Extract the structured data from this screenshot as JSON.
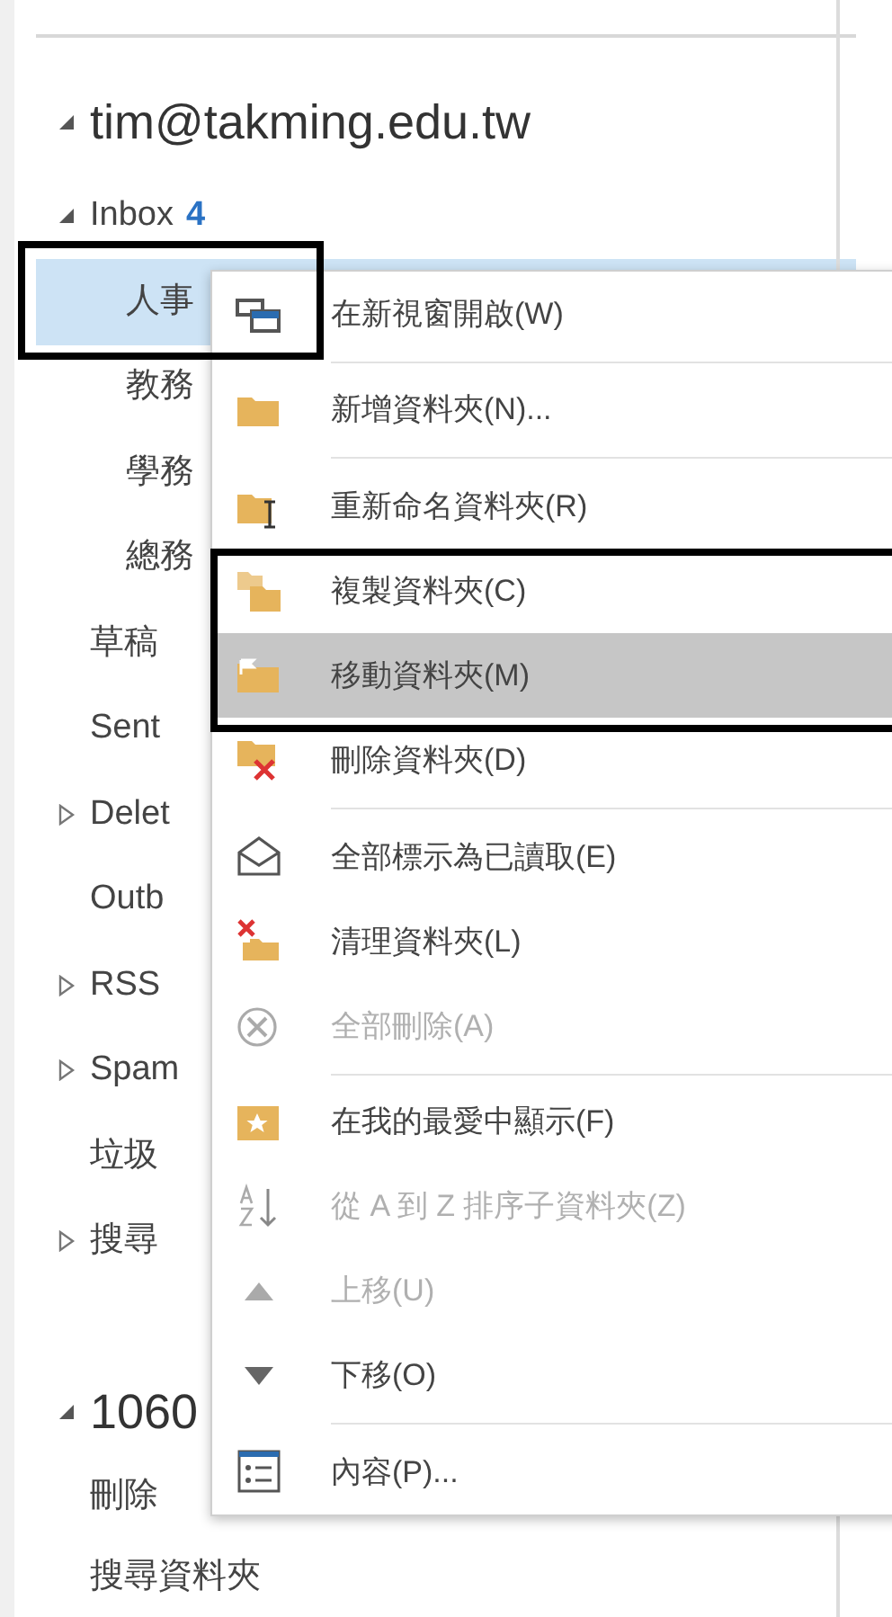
{
  "accounts": [
    {
      "name": "tim@takming.edu.tw",
      "expanded": true,
      "children": [
        {
          "name": "Inbox",
          "count": "4",
          "expanded": true,
          "selected": false,
          "children": [
            {
              "name": "人事",
              "selected": true
            },
            {
              "name": "教務",
              "selected": false
            },
            {
              "name": "學務",
              "selected": false
            },
            {
              "name": "總務",
              "selected": false
            }
          ]
        },
        {
          "name": "草稿",
          "selected": false
        },
        {
          "name": "Sent",
          "selected": false
        },
        {
          "name": "Delet",
          "expanded": false,
          "selected": false
        },
        {
          "name": "Outb",
          "selected": false
        },
        {
          "name": "RSS",
          "expanded": false,
          "selected": false
        },
        {
          "name": "Spam",
          "expanded": false,
          "selected": false
        },
        {
          "name": "垃圾",
          "selected": false
        },
        {
          "name": "搜尋",
          "expanded": false,
          "selected": false
        }
      ]
    },
    {
      "name": "1060",
      "expanded": true,
      "children": [
        {
          "name": "刪除",
          "selected": false
        },
        {
          "name": "搜尋資料夾",
          "selected": false
        }
      ]
    }
  ],
  "context_menu": [
    {
      "kind": "item",
      "label": "在新視窗開啟(W)",
      "disabled": false,
      "selected": false
    },
    {
      "kind": "separator"
    },
    {
      "kind": "item",
      "label": "新增資料夾(N)...",
      "disabled": false,
      "selected": false
    },
    {
      "kind": "separator"
    },
    {
      "kind": "item",
      "label": "重新命名資料夾(R)",
      "disabled": false,
      "selected": false
    },
    {
      "kind": "item",
      "label": "複製資料夾(C)",
      "disabled": false,
      "selected": false
    },
    {
      "kind": "item",
      "label": "移動資料夾(M)",
      "disabled": false,
      "selected": true
    },
    {
      "kind": "item",
      "label": "刪除資料夾(D)",
      "disabled": false,
      "selected": false
    },
    {
      "kind": "separator"
    },
    {
      "kind": "item",
      "label": "全部標示為已讀取(E)",
      "disabled": false,
      "selected": false
    },
    {
      "kind": "item",
      "label": "清理資料夾(L)",
      "disabled": false,
      "selected": false
    },
    {
      "kind": "item",
      "label": "全部刪除(A)",
      "disabled": true,
      "selected": false
    },
    {
      "kind": "separator"
    },
    {
      "kind": "item",
      "label": "在我的最愛中顯示(F)",
      "disabled": false,
      "selected": false
    },
    {
      "kind": "item",
      "label": "從 A 到 Z 排序子資料夾(Z)",
      "disabled": true,
      "selected": false
    },
    {
      "kind": "item",
      "label": "上移(U)",
      "disabled": true,
      "selected": false
    },
    {
      "kind": "item",
      "label": "下移(O)",
      "disabled": false,
      "selected": false
    },
    {
      "kind": "separator"
    },
    {
      "kind": "item",
      "label": "內容(P)...",
      "disabled": false,
      "selected": false
    }
  ]
}
